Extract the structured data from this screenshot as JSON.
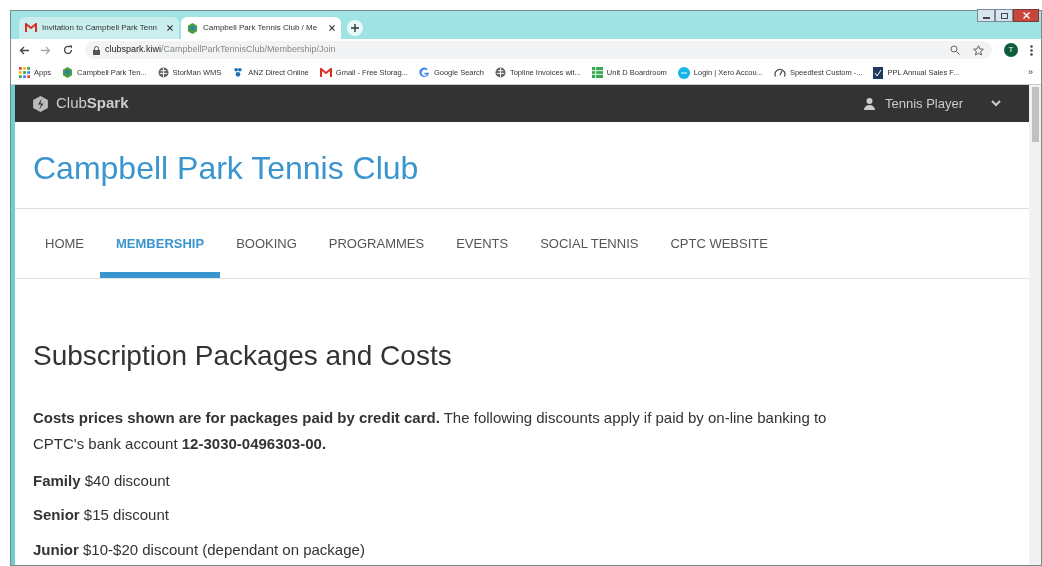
{
  "browser": {
    "tabs": [
      {
        "title": "Invitation to Campbell Park Tenn",
        "selected": false
      },
      {
        "title": "Campbell Park Tennis Club / Me",
        "selected": true
      }
    ],
    "url_host": "clubspark.kiwi",
    "url_path": "/CampbellParkTennisClub/Membership/Join",
    "avatar": "T",
    "bookmarks": [
      {
        "label": "Apps"
      },
      {
        "label": "Campbell Park Ten..."
      },
      {
        "label": "StorMan WMS"
      },
      {
        "label": "ANZ Direct Online"
      },
      {
        "label": "Gmail - Free Storag..."
      },
      {
        "label": "Google Search"
      },
      {
        "label": "Topline Invoices wit..."
      },
      {
        "label": "Unit D Boardroom"
      },
      {
        "label": "Login | Xero Accou..."
      },
      {
        "label": "Speedtest Custom -..."
      },
      {
        "label": "PPL Annual Sales F..."
      }
    ],
    "more": "»"
  },
  "site": {
    "brand_light": "Club",
    "brand_bold": "Spark",
    "user": "Tennis Player",
    "club_title": "Campbell Park Tennis Club",
    "nav": [
      {
        "label": "HOME",
        "selected": false
      },
      {
        "label": "MEMBERSHIP",
        "selected": true
      },
      {
        "label": "BOOKING",
        "selected": false
      },
      {
        "label": "PROGRAMMES",
        "selected": false
      },
      {
        "label": "EVENTS",
        "selected": false
      },
      {
        "label": "SOCIAL TENNIS",
        "selected": false
      },
      {
        "label": "CPTC WEBSITE",
        "selected": false
      }
    ]
  },
  "content": {
    "heading": "Subscription Packages and Costs",
    "paragraphs": [
      "**Costs prices shown are for packages paid by credit card.** The following discounts apply if paid by on-line banking to CPTC's bank account  **12-3030-0496303-00.**",
      "**Family** $40 discount",
      "**Senior** $15 discount",
      "**Junior** $10-$20 discount (dependant on package)"
    ]
  }
}
